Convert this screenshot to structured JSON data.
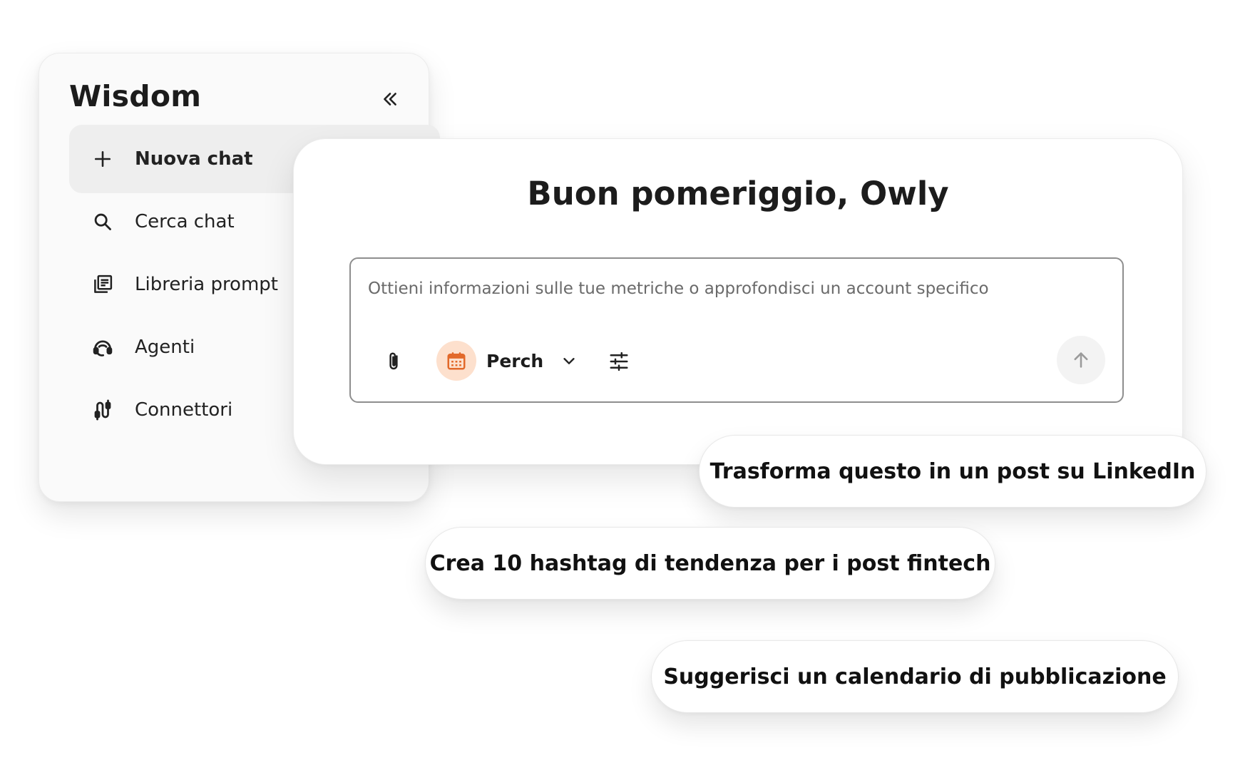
{
  "sidebar": {
    "title": "Wisdom",
    "collapse_icon": "double-chevron-left-icon",
    "items": [
      {
        "label": "Nuova chat",
        "icon": "plus-icon",
        "active": true
      },
      {
        "label": "Cerca chat",
        "icon": "search-icon",
        "active": false
      },
      {
        "label": "Libreria prompt",
        "icon": "library-icon",
        "active": false
      },
      {
        "label": "Agenti",
        "icon": "agent-headset-icon",
        "active": false
      },
      {
        "label": "Connettori",
        "icon": "connector-icon",
        "active": false
      }
    ]
  },
  "chat": {
    "greeting": "Buon pomeriggio, Owly",
    "composer": {
      "placeholder": "Ottieni informazioni sulle tue metriche o approfondisci un account specifico",
      "value": "",
      "attach_icon": "paperclip-icon",
      "account": {
        "name": "Perch",
        "icon": "calendar-icon",
        "avatar_color": "#fde0cd",
        "icon_color": "#e2692a"
      },
      "settings_icon": "sliders-icon",
      "send_icon": "arrow-up-icon"
    }
  },
  "suggestions": [
    "Trasforma questo in un post su LinkedIn",
    "Crea 10 hashtag di tendenza per i post fintech",
    "Suggerisci un calendario di pubblicazione"
  ]
}
